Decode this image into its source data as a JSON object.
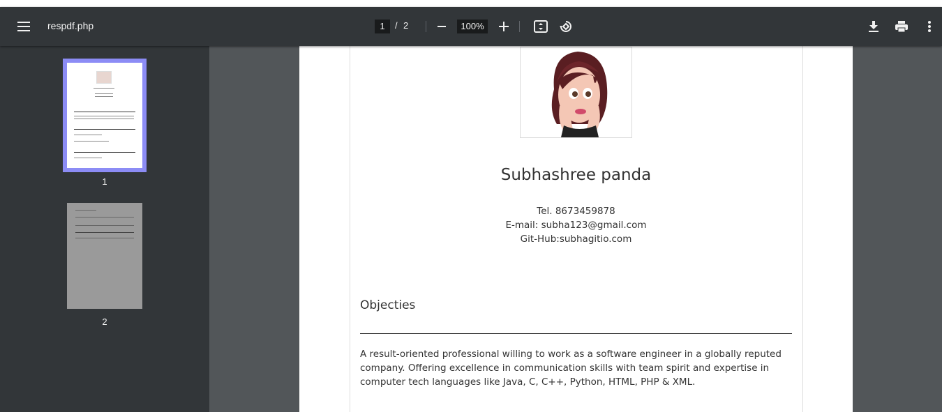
{
  "toolbar": {
    "title": "respdf.php",
    "current_page": "1",
    "page_separator": "/",
    "total_pages": "2",
    "zoom": "100%",
    "icons": [
      "menu-icon",
      "zoom-out-icon",
      "zoom-in-icon",
      "fit-page-icon",
      "rotate-icon",
      "download-icon",
      "print-icon",
      "more-icon"
    ]
  },
  "sidebar": {
    "thumbnails": [
      {
        "label": "1",
        "selected": true
      },
      {
        "label": "2",
        "selected": false
      }
    ],
    "selected_border_color": "#8c8cf5"
  },
  "document": {
    "name": "Subhashree panda",
    "phone": "Tel. 8673459878",
    "email": "E-mail: subha123@gmail.com",
    "github": "Git-Hub:subhagitio.com",
    "section_title": "Objecties",
    "objective_text": "A result-oriented professional willing to work as a software engineer in a globally reputed company. Offering excellence in communication skills with team spirit and expertise in computer tech languages like Java, C, C++, Python, HTML, PHP & XML."
  },
  "colors": {
    "toolbar_bg": "#323639",
    "viewer_bg": "#525659",
    "page_bg": "#ffffff"
  }
}
